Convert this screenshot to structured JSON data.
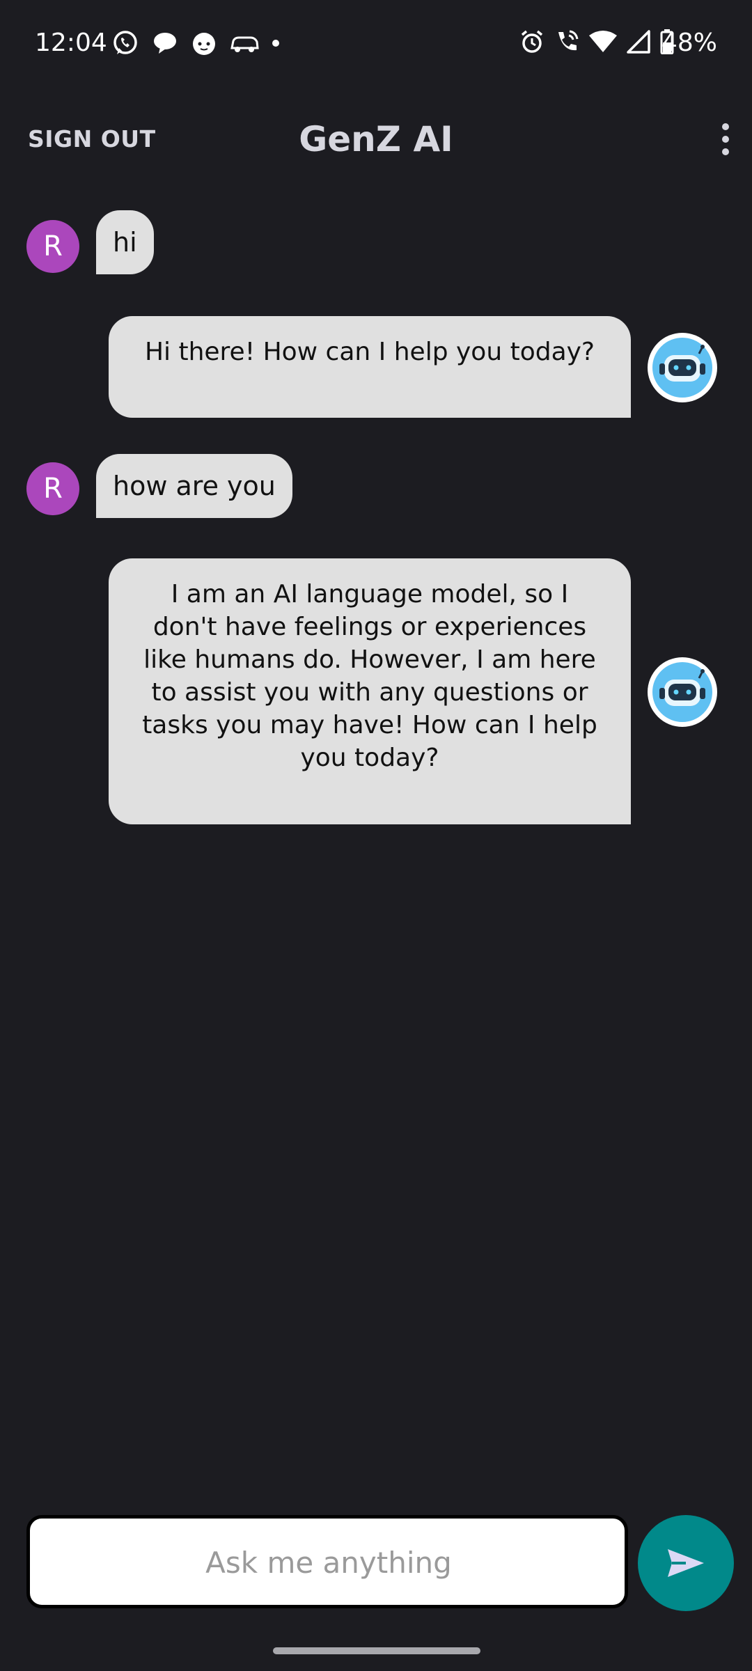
{
  "status_bar": {
    "time": "12:04",
    "battery_percent": "48%",
    "notification_icons": [
      "whatsapp-icon",
      "chat-bubble-icon",
      "cat-app-icon",
      "car-icon",
      "more-dot-icon"
    ],
    "system_icons": [
      "alarm-icon",
      "wifi-calling-icon",
      "wifi-icon",
      "cell-signal-icon",
      "battery-icon"
    ]
  },
  "app_bar": {
    "sign_out_label": "SIGN OUT",
    "title": "GenZ AI",
    "menu_icon": "more-vert-icon"
  },
  "messages": [
    {
      "sender": "user",
      "avatar_letter": "R",
      "text": "hi"
    },
    {
      "sender": "bot",
      "text": "Hi there! How can I help you today?"
    },
    {
      "sender": "user",
      "avatar_letter": "R",
      "text": "how are you"
    },
    {
      "sender": "bot",
      "text": "I am an AI language model, so I don't have feelings or experiences like humans do. However, I am here to assist you with any questions or tasks you may have! How can I help you today?"
    }
  ],
  "composer": {
    "value": "",
    "placeholder": "Ask me anything",
    "send_icon": "send-icon"
  },
  "colors": {
    "background": "#1c1c21",
    "bubble": "#e0e0e0",
    "user_avatar": "#ab47bc",
    "send_button": "#01898a",
    "header_text": "#d7d7df"
  }
}
